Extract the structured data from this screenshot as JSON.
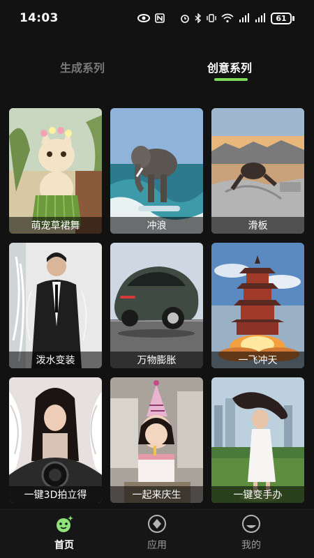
{
  "status_bar": {
    "time": "14:03",
    "battery": "61",
    "icons": [
      "eye-icon",
      "nfc-icon",
      "alarm-icon",
      "bluetooth-icon",
      "vibrate-icon",
      "wifi-icon",
      "signal-icon",
      "signal-icon"
    ]
  },
  "tabs": [
    {
      "label": "生成系列",
      "active": false
    },
    {
      "label": "创意系列",
      "active": true
    }
  ],
  "accent_color": "#7ed957",
  "cards": [
    {
      "label": "萌宠草裙舞"
    },
    {
      "label": "冲浪"
    },
    {
      "label": "滑板"
    },
    {
      "label": "泼水变装"
    },
    {
      "label": "万物膨胀"
    },
    {
      "label": "一飞冲天"
    },
    {
      "label": "一键3D拍立得"
    },
    {
      "label": "一起来庆生"
    },
    {
      "label": "一键变手办"
    }
  ],
  "nav": [
    {
      "label": "首页",
      "icon": "home-icon",
      "active": true
    },
    {
      "label": "应用",
      "icon": "apps-icon",
      "active": false
    },
    {
      "label": "我的",
      "icon": "profile-icon",
      "active": false
    }
  ]
}
